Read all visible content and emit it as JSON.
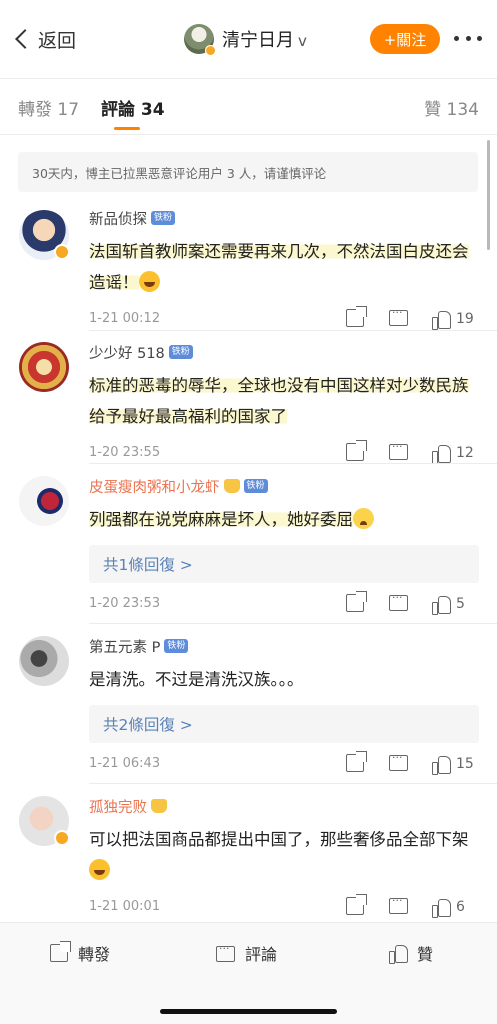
{
  "header": {
    "back_label": "返回",
    "username": "清宁日月",
    "verified_mark": "v",
    "follow_label": "+關注"
  },
  "tabs": {
    "repost": "轉發 17",
    "comment": "評論 34",
    "like": "贊 134"
  },
  "notice": "30天内，博主已拉黑恶意评论用户 3 人，请谨慎评论",
  "comments": [
    {
      "user": "新品侦探",
      "badge": "铁粉",
      "text": "法国斩首教师案还需要再来几次，不然法国白皮还会造谣！",
      "emoji": "laugh-emoji",
      "time": "1-21 00:12",
      "likes": "19"
    },
    {
      "user": "少少好 518",
      "badge": "铁粉",
      "text": "标准的恶毒的辱华，全球也没有中国这样对少数民族给予最好最高福利的国家了",
      "time": "1-20 23:55",
      "likes": "12"
    },
    {
      "user": "皮蛋瘦肉粥和小龙虾",
      "badge": "铁粉",
      "text": "列强都在说党麻麻是坏人，她好委屈",
      "emoji": "cry-emoji",
      "replies": "共1條回復 >",
      "time": "1-20 23:53",
      "likes": "5"
    },
    {
      "user": "第五元素 P",
      "badge": "铁粉",
      "text": "是清洗。不过是清洗汉族。。。",
      "replies": "共2條回復 >",
      "time": "1-21 06:43",
      "likes": "15"
    },
    {
      "user": "孤独完败",
      "text": "可以把法国商品都提出中国了，那些奢侈品全部下架",
      "emoji": "laugh-cry-emoji",
      "time": "1-21 00:01",
      "likes": "6"
    }
  ],
  "bottom_bar": {
    "repost": "轉發",
    "comment": "評論",
    "like": "贊"
  },
  "colors": {
    "accent": "#ff8200",
    "link": "#5b82b8",
    "vip_name": "#eb7350",
    "fan_badge": "#5e8cd8",
    "highlight": "#fbf7cf"
  }
}
